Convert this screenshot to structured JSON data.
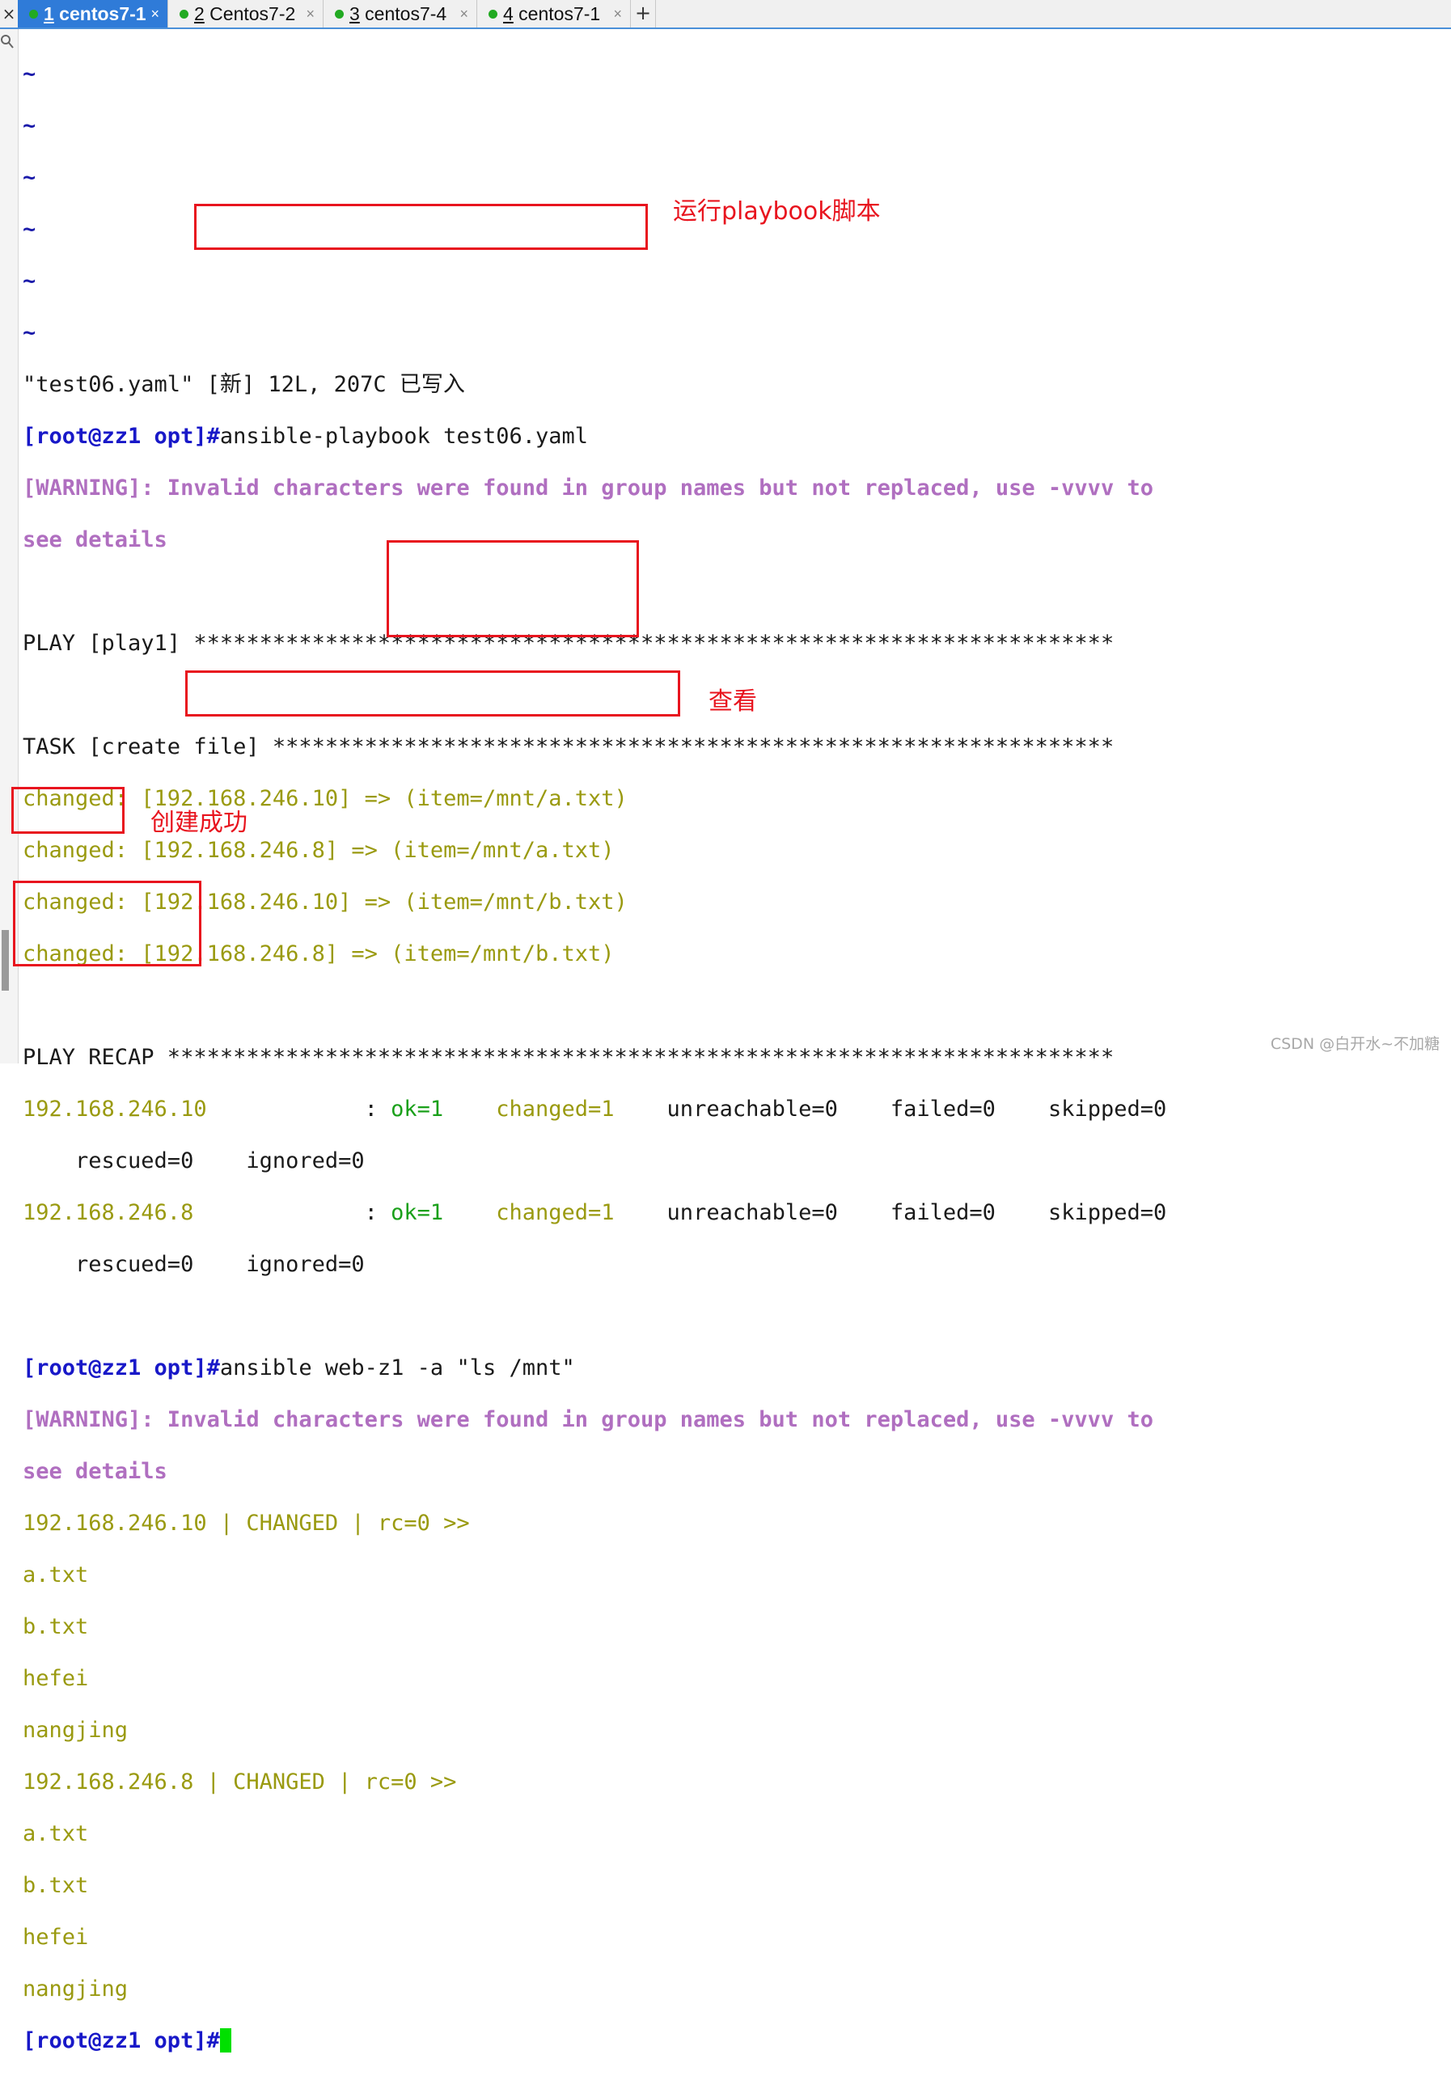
{
  "tabs": [
    {
      "number": "1",
      "label": " centos7-1",
      "close": "×",
      "active": true
    },
    {
      "number": "2",
      "label": " Centos7-2",
      "close": "×",
      "active": false
    },
    {
      "number": "3",
      "label": " centos7-4",
      "close": "×",
      "active": false
    },
    {
      "number": "4",
      "label": " centos7-1",
      "close": "×",
      "active": false
    }
  ],
  "tab_add": "+",
  "left_close": "×",
  "terminal": {
    "tilde": "~",
    "file_status": "\"test06.yaml\" [新] 12L, 207C 已写入",
    "prompt": "[root@zz1 opt]#",
    "cmd1": "ansible-playbook test06.yaml",
    "warn1a": "[WARNING]: Invalid characters were found in group names but not replaced, use -vvvv to",
    "warn1b": "see details",
    "play": "PLAY [play1] **********************************************************************",
    "task": "TASK [create file] ****************************************************************",
    "changed_lines": [
      "changed: [192.168.246.10] => (item=/mnt/a.txt)",
      "changed: [192.168.246.8] => (item=/mnt/a.txt)",
      "changed: [192.168.246.10] => (item=/mnt/b.txt)",
      "changed: [192.168.246.8] => (item=/mnt/b.txt)"
    ],
    "recap": "PLAY RECAP ************************************************************************",
    "recap_hosts": [
      {
        "host": "192.168.246.10            ",
        "colon": ": ",
        "ok": "ok=1",
        "gap": "    ",
        "changed": "changed=1",
        "rest": "    unreachable=0    failed=0    skipped=0",
        "line2": "    rescued=0    ignored=0"
      },
      {
        "host": "192.168.246.8             ",
        "colon": ": ",
        "ok": "ok=1",
        "gap": "    ",
        "changed": "changed=1",
        "rest": "    unreachable=0    failed=0    skipped=0",
        "line2": "    rescued=0    ignored=0"
      }
    ],
    "cmd2": "ansible web-z1 -a \"ls /mnt\"",
    "warn2a": "[WARNING]: Invalid characters were found in group names but not replaced, use -vvvv to",
    "warn2b": "see details",
    "host10_result": "192.168.246.10 | CHANGED | rc=0 >>",
    "host8_result": "192.168.246.8 | CHANGED | rc=0 >>",
    "files": [
      "a.txt",
      "b.txt",
      "hefei",
      "nangjing"
    ]
  },
  "annotations": {
    "run_playbook": "运行playbook脚本",
    "view": "查看",
    "created": "创建成功"
  },
  "watermark": "CSDN @白开水~不加糖",
  "colors": {
    "tab_active": "#2f7bd8",
    "prompt": "#1818c8",
    "warning": "#b06fc0",
    "output": "#9a9a10",
    "ok": "#1aa01a",
    "annotation": "#e8141e",
    "cursor": "#00e000"
  }
}
